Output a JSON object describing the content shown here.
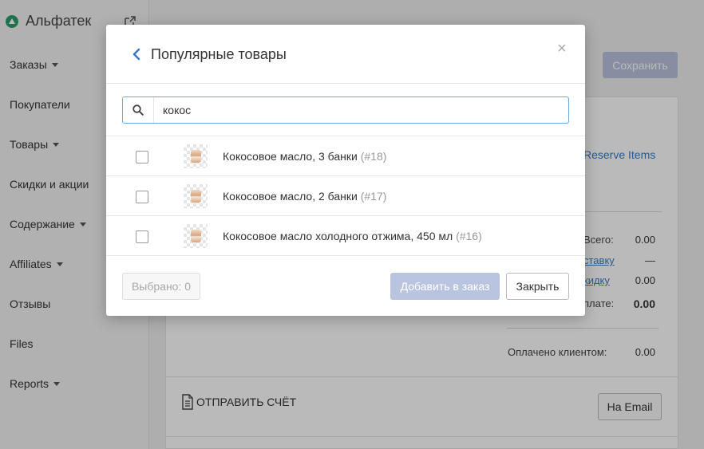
{
  "sidebar": {
    "brand": "Альфатек",
    "items": [
      {
        "label": "Заказы",
        "caret": true
      },
      {
        "label": "Покупатели",
        "caret": false
      },
      {
        "label": "Товары",
        "caret": true
      },
      {
        "label": "Скидки и акции",
        "caret": false
      },
      {
        "label": "Содержание",
        "caret": true
      },
      {
        "label": "Affiliates",
        "caret": true
      },
      {
        "label": "Отзывы",
        "caret": false
      },
      {
        "label": "Files",
        "caret": false
      },
      {
        "label": "Reports",
        "caret": true
      }
    ]
  },
  "main": {
    "save_label": "Сохранить",
    "reserve_label": "Reserve Items",
    "summary": {
      "total_label": "Всего:",
      "total_value": "0.00",
      "delivery_label": "ставку",
      "delivery_value": "—",
      "discount_label": "кидку",
      "discount_value": "0.00",
      "to_pay_label": "плате:",
      "to_pay_value": "0.00",
      "paid_label": "Оплачено клиентом:",
      "paid_value": "0.00"
    },
    "send_invoice_label": "ОТПРАВИТЬ СЧЁТ",
    "email_button": "На Email"
  },
  "modal": {
    "title": "Популярные товары",
    "close_symbol": "×",
    "search": {
      "value": "кокос",
      "placeholder": ""
    },
    "products": [
      {
        "name": "Кокосовое масло, 3 банки",
        "sku": "(#18)"
      },
      {
        "name": "Кокосовое масло, 2 банки",
        "sku": "(#17)"
      },
      {
        "name": "Кокосовое масло холодного отжима, 450 мл",
        "sku": "(#16)"
      }
    ],
    "selected_label": "Выбрано: 0",
    "add_label": "Добавить в заказ",
    "close_label": "Закрыть"
  },
  "colors": {
    "accent": "#3a7bbf",
    "primary_disabled": "#b8c4e0",
    "brand_logo": "#2d9c6a"
  }
}
